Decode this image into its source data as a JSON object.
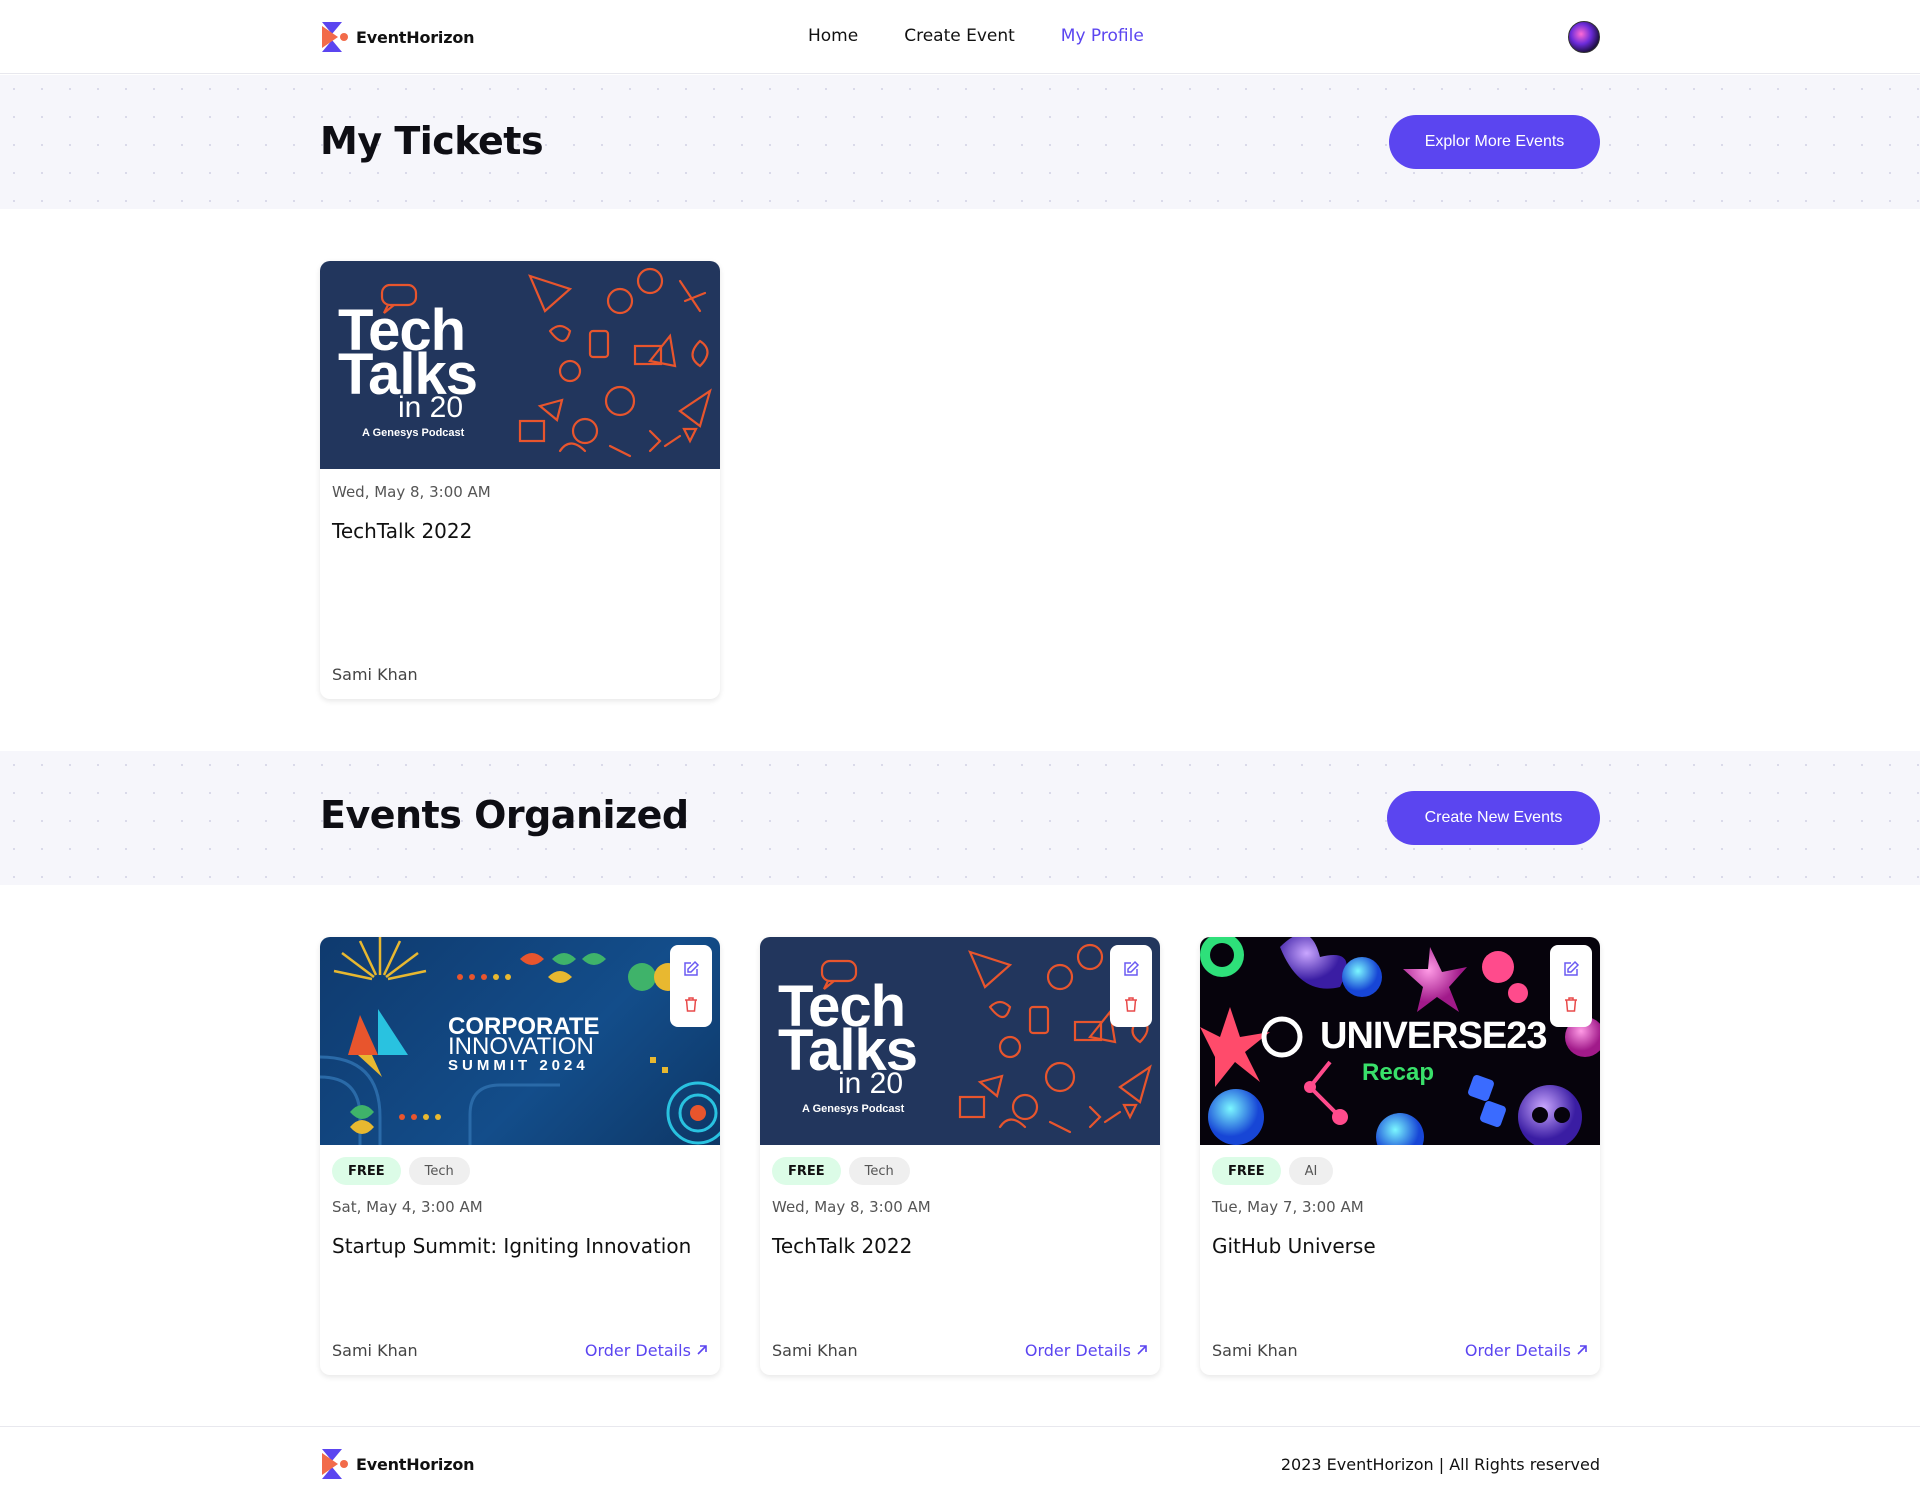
{
  "brand": {
    "name": "EventHorizon"
  },
  "nav": {
    "home": "Home",
    "create_event": "Create Event",
    "my_profile": "My Profile"
  },
  "tickets_section": {
    "title": "My Tickets",
    "button": "Explor More Events"
  },
  "organized_section": {
    "title": "Events Organized",
    "button": "Create New Events"
  },
  "tickets": [
    {
      "date": "Wed, May 8, 3:00 AM",
      "title": "TechTalk 2022",
      "organizer": "Sami Khan",
      "image": {
        "line1": "Tech",
        "line2": "Talks",
        "line3": "in 20",
        "line4": "A Genesys Podcast"
      }
    }
  ],
  "events": [
    {
      "price_tag": "FREE",
      "category": "Tech",
      "date": "Sat, May 4, 3:00 AM",
      "title": "Startup Summit: Igniting Innovation",
      "organizer": "Sami Khan",
      "order_link": "Order Details",
      "image": {
        "line1": "CORPORATE",
        "line2": "INNOVATION",
        "line3": "SUMMIT 2024"
      }
    },
    {
      "price_tag": "FREE",
      "category": "Tech",
      "date": "Wed, May 8, 3:00 AM",
      "title": "TechTalk 2022",
      "organizer": "Sami Khan",
      "order_link": "Order Details",
      "image": {
        "line1": "Tech",
        "line2": "Talks",
        "line3": "in 20",
        "line4": "A Genesys Podcast"
      }
    },
    {
      "price_tag": "FREE",
      "category": "AI",
      "date": "Tue, May 7, 3:00 AM",
      "title": "GitHub Universe",
      "organizer": "Sami Khan",
      "order_link": "Order Details",
      "image": {
        "line1": "UNIVERSE23",
        "line2": "Recap"
      }
    }
  ],
  "footer": {
    "brand": "EventHorizon",
    "copyright": "2023 EventHorizon | All Rights reserved"
  },
  "colors": {
    "accent": "#5b45f0",
    "free_tag_bg": "#dcfce7",
    "band_bg": "#f6f6fb",
    "logo_orange": "#f26b4a"
  },
  "icons": {
    "edit": "edit-icon",
    "delete": "trash-icon",
    "arrow": "arrow-up-right-icon"
  }
}
